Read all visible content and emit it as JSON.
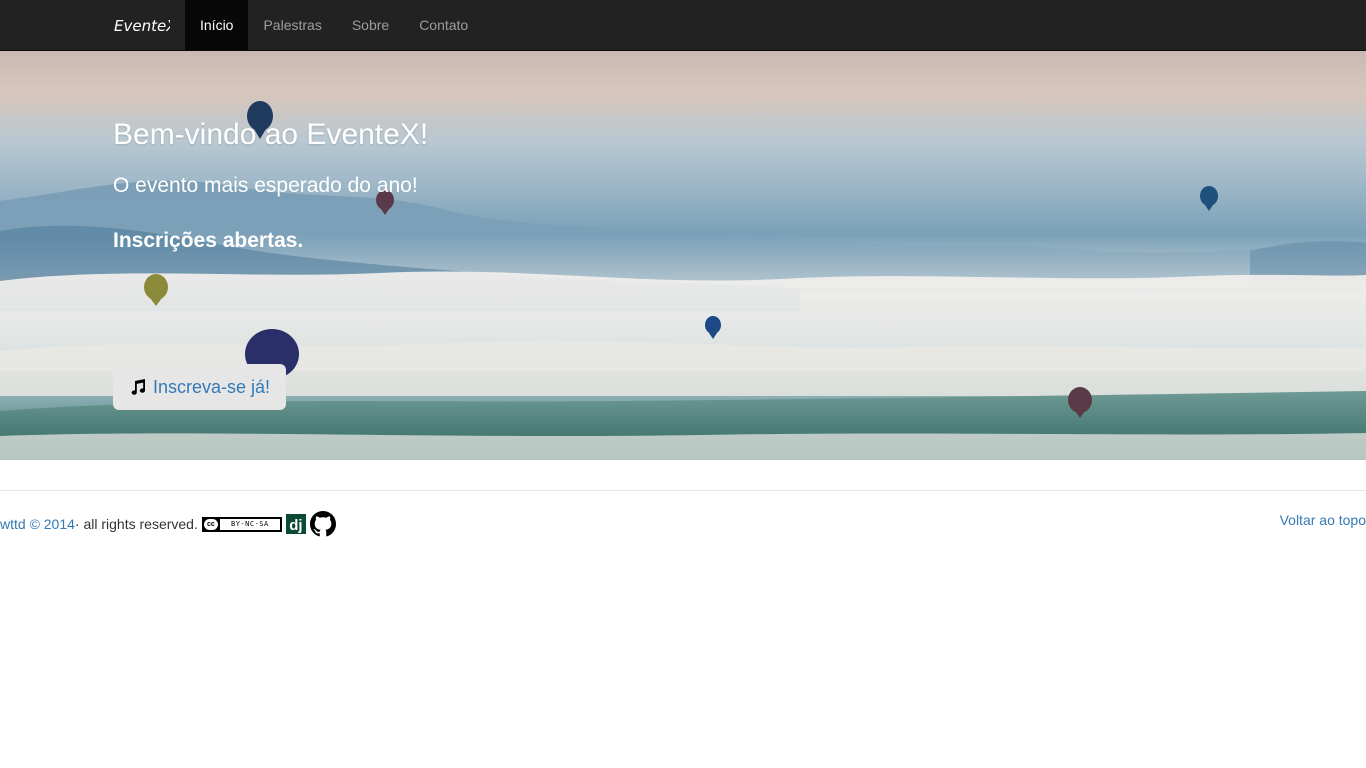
{
  "navbar": {
    "brand": "EventeX",
    "items": [
      {
        "label": "Início",
        "active": true
      },
      {
        "label": "Palestras",
        "active": false
      },
      {
        "label": "Sobre",
        "active": false
      },
      {
        "label": "Contato",
        "active": false
      }
    ]
  },
  "hero": {
    "title": "Bem-vindo ao EventeX!",
    "subtitle": "O evento mais esperado do ano!",
    "highlight": "Inscrições abertas.",
    "cta_label": "Inscreva-se já!",
    "cta_icon": "music-note-icon"
  },
  "footer": {
    "credit_link": "wttd © 2014",
    "rights": " · all rights reserved.",
    "license_badge": {
      "circle": "cc",
      "text": "BY-NC-SA"
    },
    "django_badge": "dj",
    "github_icon": "github-icon",
    "back_to_top": "Voltar ao topo"
  },
  "colors": {
    "navbar_bg": "#222222",
    "nav_active_bg": "#080808",
    "link": "#337ab7",
    "django_green": "#0c4b33"
  }
}
